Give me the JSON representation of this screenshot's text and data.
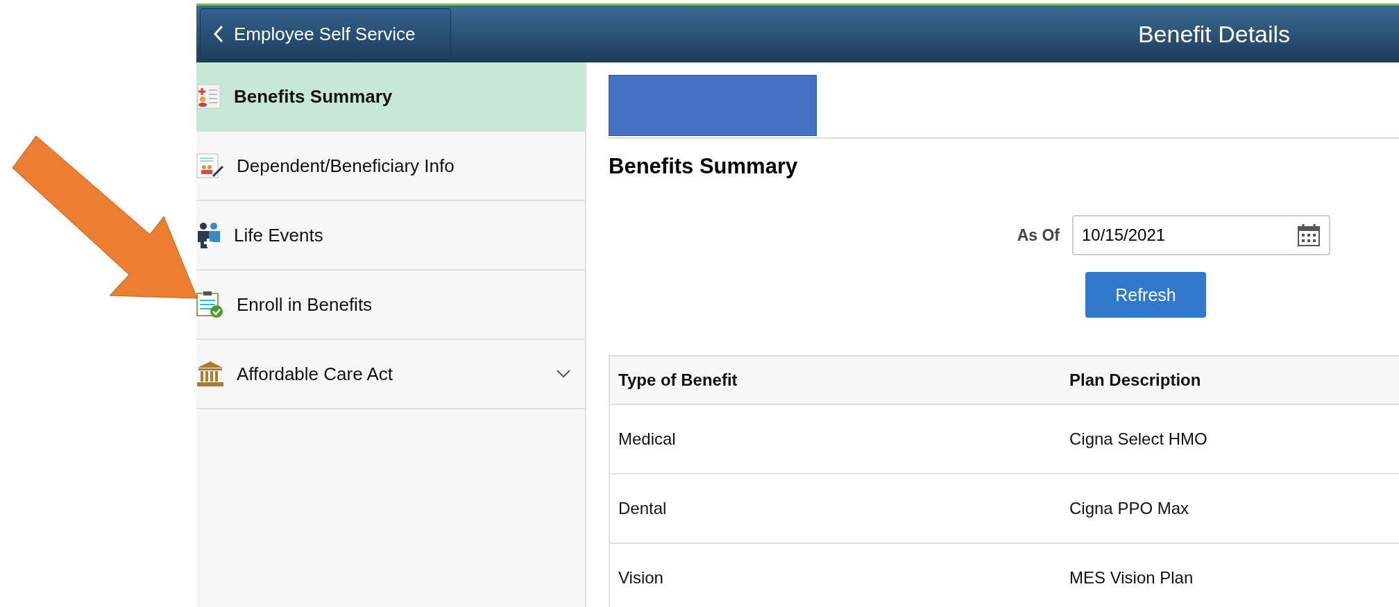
{
  "header": {
    "back_button": "Employee Self Service",
    "title": "Benefit Details"
  },
  "sidebar": {
    "items": [
      {
        "label": "Benefits Summary",
        "kind": "summary",
        "selected": true
      },
      {
        "label": "Dependent/Beneficiary Info",
        "kind": "dependents",
        "selected": false
      },
      {
        "label": "Life Events",
        "kind": "people",
        "selected": false
      },
      {
        "label": "Enroll in Benefits",
        "kind": "enroll",
        "selected": false
      },
      {
        "label": "Affordable Care Act",
        "kind": "building",
        "selected": false,
        "expanded": false
      }
    ]
  },
  "main": {
    "heading": "Benefits Summary",
    "as_of": {
      "label": "As Of",
      "value": "10/15/2021"
    },
    "refresh_button": "Refresh",
    "table": {
      "columns": [
        "Type of Benefit",
        "Plan Description"
      ],
      "rows": [
        [
          "Medical",
          "Cigna Select HMO"
        ],
        [
          "Dental",
          "Cigna PPO Max"
        ],
        [
          "Vision",
          "MES Vision Plan"
        ]
      ]
    }
  }
}
